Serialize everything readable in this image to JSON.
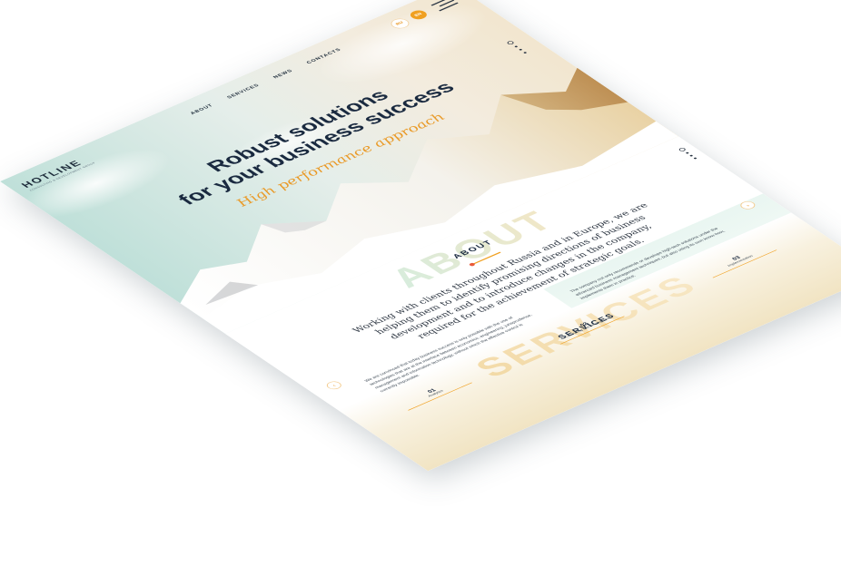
{
  "header": {
    "logo_name": "HOTLINE",
    "logo_tagline": "CONSULTING & DEVELOPMENT GROUP",
    "nav": [
      "ABOUT",
      "SERVICES",
      "NEWS",
      "CONTACTS"
    ],
    "lang_ru": "RU",
    "lang_en": "EN"
  },
  "hero": {
    "title_line1": "Robust solutions",
    "title_line2": "for your business success",
    "subtitle": "High performance approach"
  },
  "about": {
    "ghost": "ABOUT",
    "title": "ABOUT",
    "lead": "Working with clients throughout Russia and in Europe, we are helping them to identify promising directions of business development and to introduce changes in the company, required for the achievement of strategic goals.",
    "col_left": "We are convinced that today business success is only possible with the use of technologies that are at the interface between economics, engineering, jurisprudence, management and information technology, without which the effective control is currently impossible.",
    "col_right": "The company not only recommends or develops high-tech solutions under the advanced business management techniques, but also using its own know-how, implements them in practice.",
    "stats": [
      {
        "num": "01",
        "label": "Analytics"
      },
      {
        "num": "02",
        "label": "Consulting and development"
      },
      {
        "num": "03",
        "label": "Implementation"
      }
    ]
  },
  "services": {
    "ghost": "SERVICES",
    "title": "SERVICES"
  },
  "colors": {
    "accent": "#f0a020",
    "navy": "#1a2a40"
  }
}
